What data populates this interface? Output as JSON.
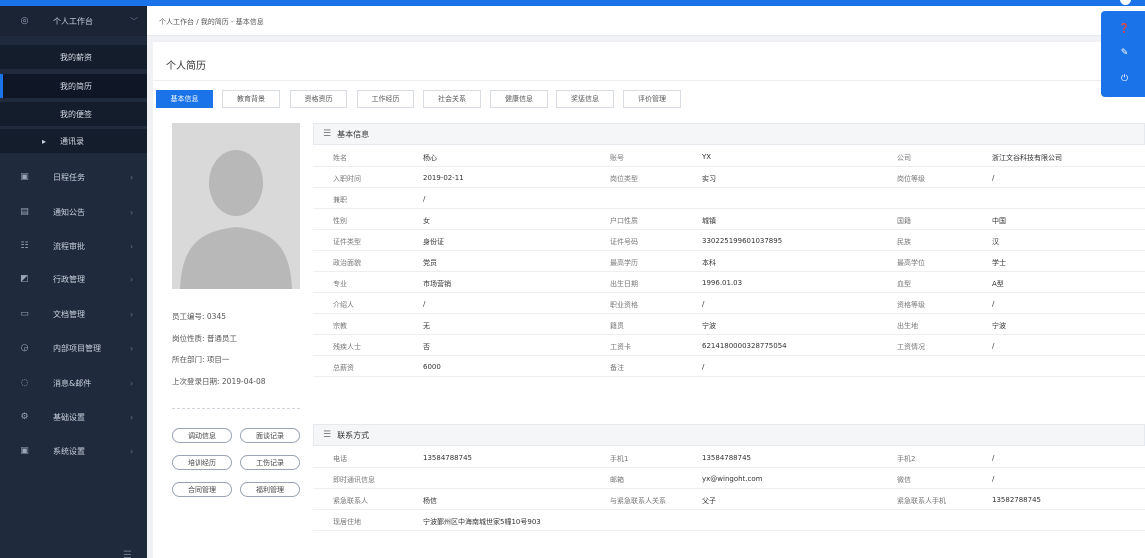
{
  "sidebar": {
    "top": {
      "label": "个人工作台",
      "icon": "target-icon"
    },
    "subs": [
      {
        "label": "我的薪资"
      },
      {
        "label": "我的简历"
      },
      {
        "label": "我的便签"
      },
      {
        "label": "通讯录"
      }
    ],
    "items": [
      {
        "label": "日程任务",
        "icon": "calendar-icon"
      },
      {
        "label": "通知公告",
        "icon": "notice-icon"
      },
      {
        "label": "流程审批",
        "icon": "flow-icon"
      },
      {
        "label": "行政管理",
        "icon": "admin-icon"
      },
      {
        "label": "文档管理",
        "icon": "folder-icon"
      },
      {
        "label": "内部项目管理",
        "icon": "project-icon"
      },
      {
        "label": "消息&邮件",
        "icon": "message-icon"
      },
      {
        "label": "基础设置",
        "icon": "gear-icon"
      },
      {
        "label": "系统设置",
        "icon": "system-icon"
      }
    ]
  },
  "breadcrumb": "个人工作台 / 我的简历 - 基本信息",
  "page_title": "个人简历",
  "tabs": [
    "基本信息",
    "教育背景",
    "资格资历",
    "工作经历",
    "社会关系",
    "健康信息",
    "奖惩信息",
    "评价管理"
  ],
  "profile": {
    "employee_no": "员工编号: 0345",
    "position_type": "岗位性质: 普通员工",
    "department": "所在部门: 项目一",
    "last_login": "上次登录日期: 2019-04-08"
  },
  "actions": [
    "调动信息",
    "面谈记录",
    "培训经历",
    "工伤记录",
    "合同管理",
    "福利管理"
  ],
  "basic_section": "基本信息",
  "basic_rows": [
    [
      "姓名",
      "杨心",
      "账号",
      "YX",
      "公司",
      "浙江文谷科技有限公司"
    ],
    [
      "入职时间",
      "2019-02-11",
      "岗位类型",
      "实习",
      "岗位等级",
      "/"
    ],
    [
      "兼职",
      "/",
      "",
      "",
      "",
      ""
    ],
    [
      "性别",
      "女",
      "户口性质",
      "城镇",
      "国籍",
      "中国"
    ],
    [
      "证件类型",
      "身份证",
      "证件号码",
      "330225199601037895",
      "民族",
      "汉"
    ],
    [
      "政治面貌",
      "党员",
      "最高学历",
      "本科",
      "最高学位",
      "学士"
    ],
    [
      "专业",
      "市场营销",
      "出生日期",
      "1996.01.03",
      "血型",
      "A型"
    ],
    [
      "介绍人",
      "/",
      "职业资格",
      "/",
      "资格等级",
      "/"
    ],
    [
      "宗教",
      "无",
      "籍贯",
      "宁波",
      "出生地",
      "宁波"
    ],
    [
      "残疾人士",
      "否",
      "工资卡",
      "6214180000328775054",
      "工资情况",
      "/"
    ],
    [
      "总薪资",
      "6000",
      "备注",
      "/",
      "",
      ""
    ]
  ],
  "contact_section": "联系方式",
  "contact_rows": [
    [
      "电话",
      "13584788745",
      "手机1",
      "13584788745",
      "手机2",
      "/"
    ],
    [
      "即时通讯信息",
      "",
      "邮箱",
      "yx@wingoht.com",
      "微信",
      "/"
    ],
    [
      "紧急联系人",
      "杨信",
      "与紧急联系人关系",
      "父子",
      "紧急联系人手机",
      "13582788745"
    ],
    [
      "现居住地",
      "宁波鄞州区中海南城世家5幢10号903",
      "",
      "",
      "",
      ""
    ]
  ],
  "colors": {
    "accent": "#1a73e8",
    "sidebar_bg": "#1f2a3c"
  }
}
